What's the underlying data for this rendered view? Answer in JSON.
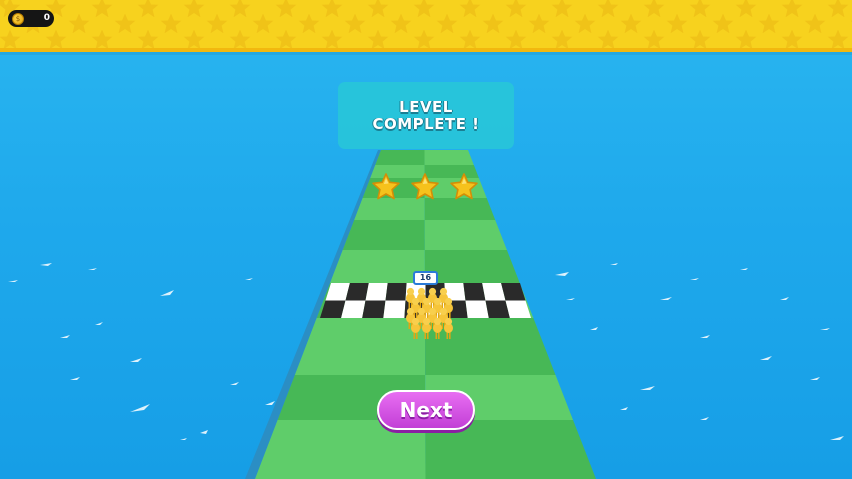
{
  "hud": {
    "coin_icon": "coin-icon",
    "coin_symbol": "$",
    "coin_count": "0"
  },
  "panel": {
    "line1": "LEVEL",
    "line2": "COMPLETE !"
  },
  "rating": {
    "stars_earned": 3,
    "stars_total": 3
  },
  "crowd": {
    "count": "16"
  },
  "next_button": {
    "label": "Next"
  },
  "colors": {
    "water": "#1fa9ec",
    "banner": "#f7d21e",
    "track_light": "#5fcd6a",
    "track_dark": "#47b856",
    "button": "#c23fd6",
    "panel": "#28c8d7"
  }
}
